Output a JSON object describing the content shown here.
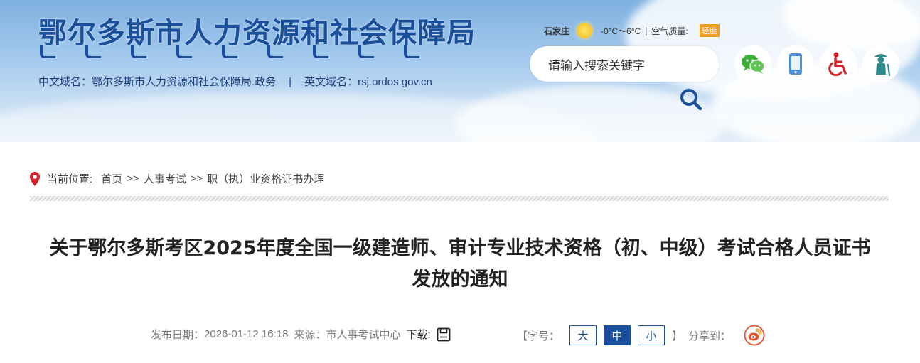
{
  "header": {
    "site_title": "鄂尔多斯市人力资源和社会保障局",
    "cn_domain": "中文域名：鄂尔多斯市人力资源和社会保障局.政务",
    "separator": "|",
    "en_domain": "英文域名：rsj.ordos.gov.cn",
    "weather": {
      "city": "石家庄",
      "icon": "sun-icon",
      "temperature": "-0°C～6°C",
      "separator": "|",
      "air_quality_label": "空气质量:",
      "air_quality_value": "轻度"
    },
    "search": {
      "placeholder": "请输入搜索关键字"
    },
    "quick_icons": [
      "wechat-icon",
      "mobile-icon",
      "accessibility-icon",
      "elderly-icon"
    ]
  },
  "breadcrumb": {
    "label": "当前位置:",
    "items": [
      "首页",
      "人事考试",
      "职（执）业资格证书办理"
    ],
    "arrow": ">>"
  },
  "article": {
    "title_line1": "关于鄂尔多斯考区2025年度全国一级建造师、审计专业技术资格（初、中级）考试合格人员证书",
    "title_line2": "发放的通知",
    "publish_label": "发布日期：",
    "publish_date": "2026-01-12 16:18",
    "source_label": "来源：",
    "source": "市人事考试中心",
    "download_label": "下载:",
    "font_size": {
      "open_bracket": "【",
      "label": "字号：",
      "large": "大",
      "medium": "中",
      "small": "小",
      "close_bracket": "】"
    },
    "share_label": "分享到："
  },
  "colors": {
    "brand_blue": "#1a4f9c",
    "breadcrumb_pin": "#d0202a",
    "weibo": "#e6502f"
  }
}
